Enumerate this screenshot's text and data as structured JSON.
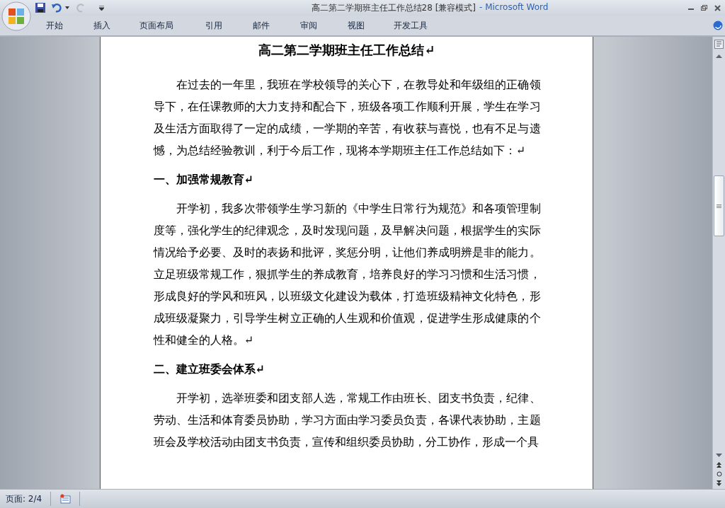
{
  "window": {
    "document_title": "高二第二学期班主任工作总结28 [兼容模式]",
    "app_title": "- Microsoft Word"
  },
  "ribbon_tabs": [
    {
      "label": "开始",
      "selected": false
    },
    {
      "label": "插入",
      "selected": false
    },
    {
      "label": "页面布局",
      "selected": false
    },
    {
      "label": "引用",
      "selected": false
    },
    {
      "label": "邮件",
      "selected": false
    },
    {
      "label": "审阅",
      "selected": false
    },
    {
      "label": "视图",
      "selected": false
    },
    {
      "label": "开发工具",
      "selected": false
    }
  ],
  "document": {
    "title": "高二第二学期班主任工作总结↵",
    "blocks": [
      {
        "kind": "paragraph",
        "text": "在过去的一年里，我班在学校领导的关心下，在教导处和年级组的正确领导下，在任课教师的大力支持和配合下，班级各项工作顺利开展，学生在学习及生活方面取得了一定的成绩，一学期的辛苦，有收获与喜悦，也有不足与遗憾，为总结经验教训，利于今后工作，现将本学期班主任工作总结如下：↵"
      },
      {
        "kind": "heading",
        "text": "一、加强常规教育↵"
      },
      {
        "kind": "paragraph",
        "text": "开学初，我多次带领学生学习新的《中学生日常行为规范》和各项管理制度等，强化学生的纪律观念，及时发现问题，及早解决问题，根据学生的实际情况给予必要、及时的表扬和批评，奖惩分明，让他们养成明辨是非的能力。立足班级常规工作，狠抓学生的养成教育，培养良好的学习习惯和生活习惯，形成良好的学风和班风，以班级文化建设为载体，打造班级精神文化特色，形成班级凝聚力，引导学生树立正确的人生观和价值观，促进学生形成健康的个性和健全的人格。↵"
      },
      {
        "kind": "heading",
        "text": "二、建立班委会体系↵"
      },
      {
        "kind": "paragraph",
        "text": "开学初，选举班委和团支部人选，常规工作由班长、团支书负责，纪律、劳动、生活和体育委员协助，学习方面由学习委员负责，各课代表协助，主题班会及学校活动由团支书负责，宣传和组织委员协助，分工协作，形成一个具"
      }
    ]
  },
  "status_bar": {
    "page": "页面: 2/4"
  }
}
